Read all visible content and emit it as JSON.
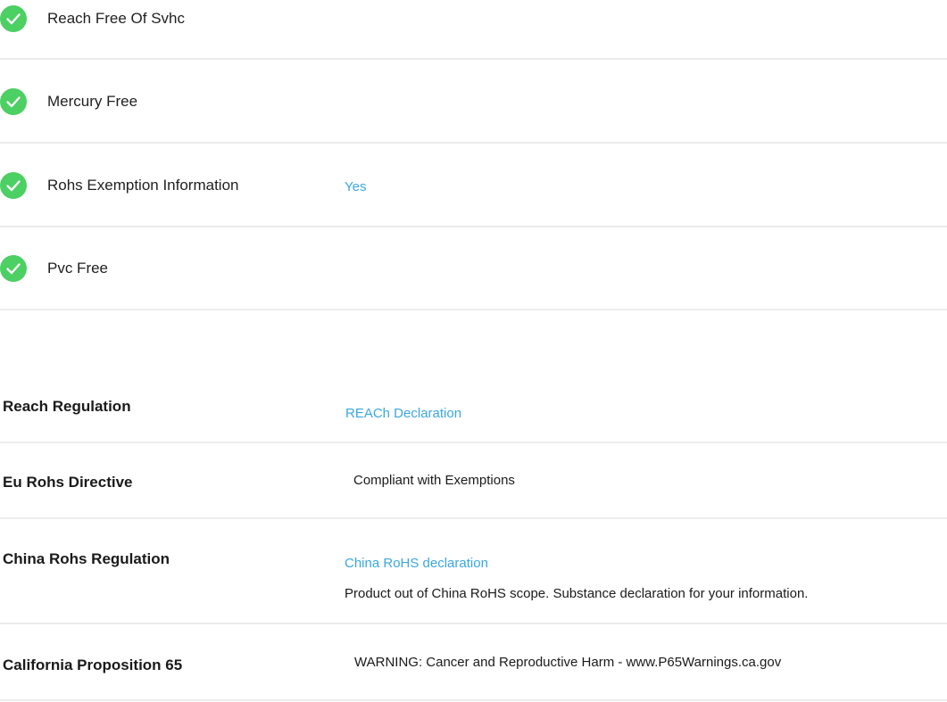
{
  "features": [
    {
      "label": "Reach Free Of Svhc",
      "value": ""
    },
    {
      "label": "Mercury Free",
      "value": ""
    },
    {
      "label": "Rohs Exemption Information",
      "value": "Yes"
    },
    {
      "label": "Pvc Free",
      "value": ""
    }
  ],
  "regulations": [
    {
      "label": "Reach Regulation",
      "link": "REACh Declaration",
      "text": "",
      "note": ""
    },
    {
      "label": "Eu Rohs Directive",
      "link": "",
      "text": "Compliant with Exemptions",
      "note": ""
    },
    {
      "label": "China Rohs Regulation",
      "link": "China RoHS declaration",
      "text": "",
      "note": "Product out of China RoHS scope. Substance declaration for your information."
    },
    {
      "label": "California Proposition 65",
      "link": "",
      "text": "WARNING: Cancer and Reproductive Harm - www.P65Warnings.ca.gov",
      "note": ""
    }
  ],
  "colors": {
    "check": "#4ccf63",
    "link": "#3aa8e0",
    "divider": "#ececec"
  },
  "icons": {
    "feature_check": "check-circle-icon"
  }
}
